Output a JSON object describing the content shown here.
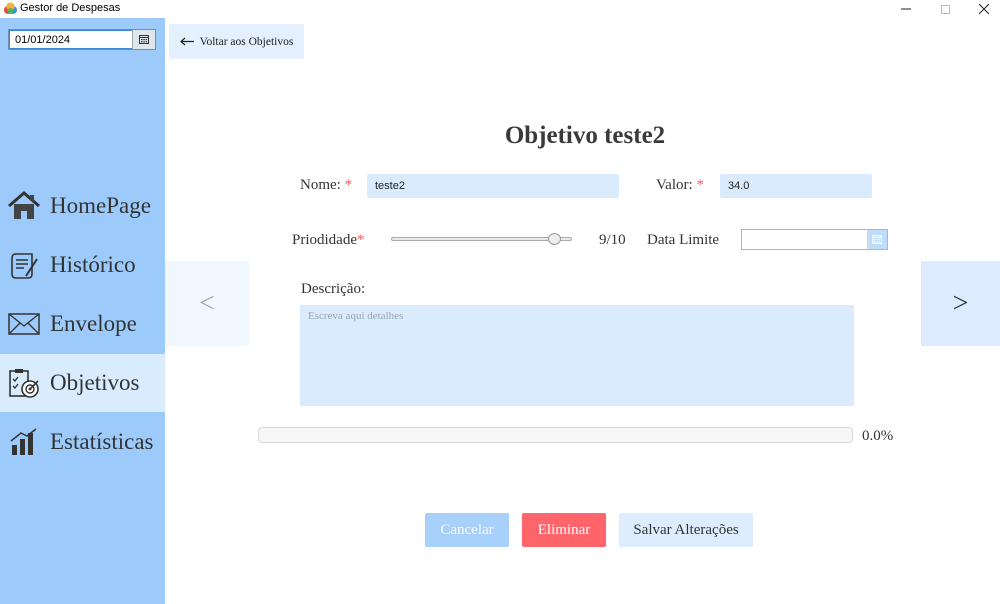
{
  "window": {
    "title": "Gestor de Despesas"
  },
  "sidebar": {
    "date": "01/01/2024",
    "items": [
      {
        "label": "HomePage",
        "icon": "home-icon"
      },
      {
        "label": "Histórico",
        "icon": "history-scroll-icon"
      },
      {
        "label": "Envelope",
        "icon": "envelope-icon"
      },
      {
        "label": "Objetivos",
        "icon": "goals-target-icon",
        "active": true
      },
      {
        "label": "Estatísticas",
        "icon": "bar-chart-icon"
      }
    ]
  },
  "header": {
    "back_label": "Voltar aos Objetivos"
  },
  "form": {
    "title": "Objetivo teste2",
    "name_label": "Nome:",
    "name_value": "teste2",
    "value_label": "Valor:",
    "value_value": "34.0",
    "required_mark": "*",
    "priority_label": "Priodidade",
    "priority_value": 9,
    "priority_max": 10,
    "priority_text": "9/10",
    "deadline_label": "Data Limite",
    "deadline_value": "",
    "description_label": "Descrição:",
    "description_placeholder": "Escreva aqui detalhes",
    "progress_fraction": 0.0,
    "progress_text": "0.0%"
  },
  "nav_arrows": {
    "prev": "<",
    "next": ">"
  },
  "actions": {
    "cancel": "Cancelar",
    "delete": "Eliminar",
    "save": "Salvar Alterações"
  },
  "colors": {
    "sidebar_bg": "#9ccbfb",
    "active_item_bg": "#d9ecfd",
    "field_bg": "#dbebfe",
    "required": "#ff5a5a",
    "cancel_bg": "#a7d0fb",
    "delete_bg": "#fd656b",
    "save_bg": "#deedfd"
  }
}
